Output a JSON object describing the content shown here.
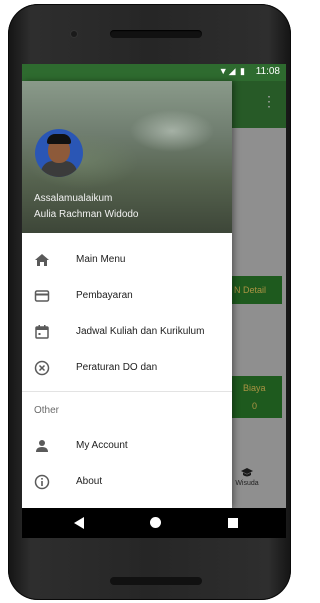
{
  "status_bar": {
    "time": "11:08",
    "signal_icons": "▼◢ ▮"
  },
  "background_app": {
    "card_button_1": "N  Detail",
    "card_button_2_line1": "Biaya",
    "card_button_2_line2": "0",
    "bottom_nav_label": "Wisuda"
  },
  "drawer": {
    "greeting": "Assalamualaikum",
    "user_name": "Aulia Rachman Widodo",
    "items": [
      {
        "label": "Main Menu",
        "icon": "home-icon"
      },
      {
        "label": "Pembayaran",
        "icon": "credit-card-icon"
      },
      {
        "label": "Jadwal Kuliah dan Kurikulum",
        "icon": "calendar-icon"
      },
      {
        "label": "Peraturan DO dan",
        "icon": "cancel-circle-icon"
      }
    ],
    "section_label": "Other",
    "other_items": [
      {
        "label": "My Account",
        "icon": "person-icon"
      },
      {
        "label": "About",
        "icon": "info-icon"
      }
    ]
  },
  "colors": {
    "status_bar": "#2e6b2f",
    "app_bar": "#3d8b3d",
    "accent_text": "#ffe066"
  }
}
